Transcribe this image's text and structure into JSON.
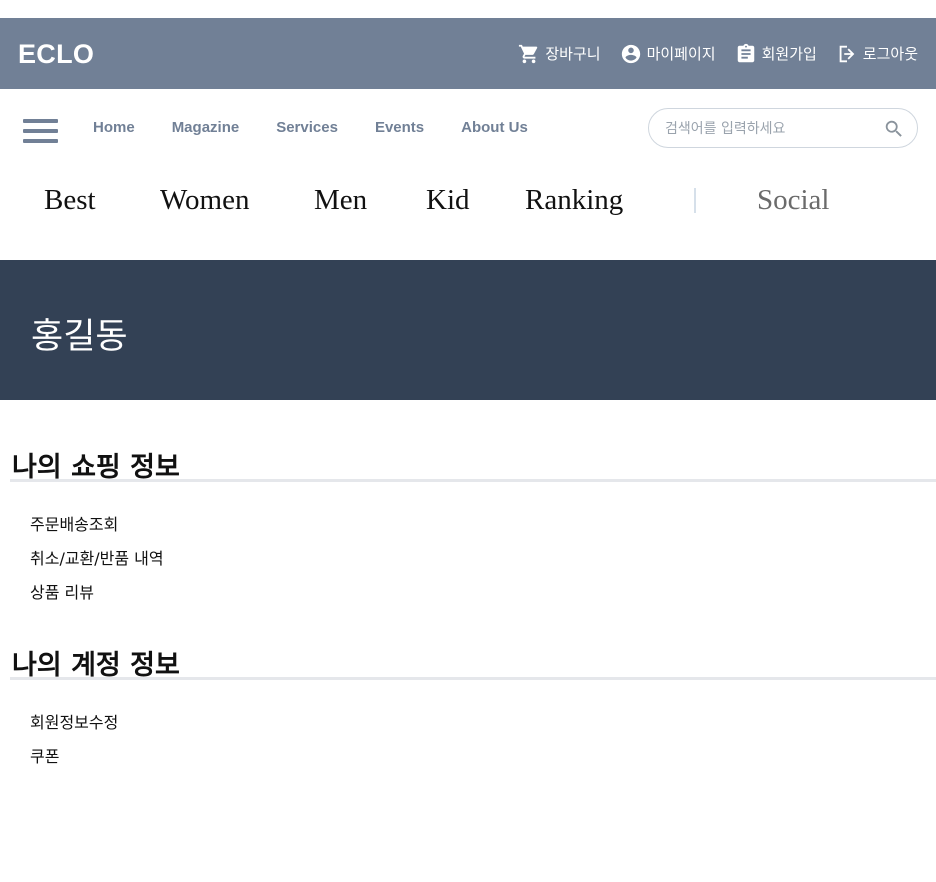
{
  "header": {
    "logo": "ECLO",
    "links": [
      {
        "icon": "cart-icon",
        "label": "장바구니"
      },
      {
        "icon": "account-circle-icon",
        "label": "마이페이지"
      },
      {
        "icon": "clipboard-icon",
        "label": "회원가입"
      },
      {
        "icon": "logout-icon",
        "label": "로그아웃"
      }
    ]
  },
  "nav": {
    "links": [
      "Home",
      "Magazine",
      "Services",
      "Events",
      "About Us"
    ],
    "search": {
      "placeholder": "검색어를 입력하세요",
      "value": ""
    }
  },
  "categories": [
    "Best",
    "Women",
    "Men",
    "Kid",
    "Ranking",
    "Social"
  ],
  "profile": {
    "name": "홍길동"
  },
  "sections": [
    {
      "title": "나의 쇼핑 정보",
      "items": [
        "주문배송조회",
        "취소/교환/반품 내역",
        "상품 리뷰"
      ]
    },
    {
      "title": "나의 계정 정보",
      "items": [
        "회원정보수정",
        "쿠폰"
      ]
    }
  ],
  "colors": {
    "header_bg": "#718096",
    "banner_bg": "#334155",
    "nav_text": "#718096",
    "rule": "#e5e7eb"
  }
}
